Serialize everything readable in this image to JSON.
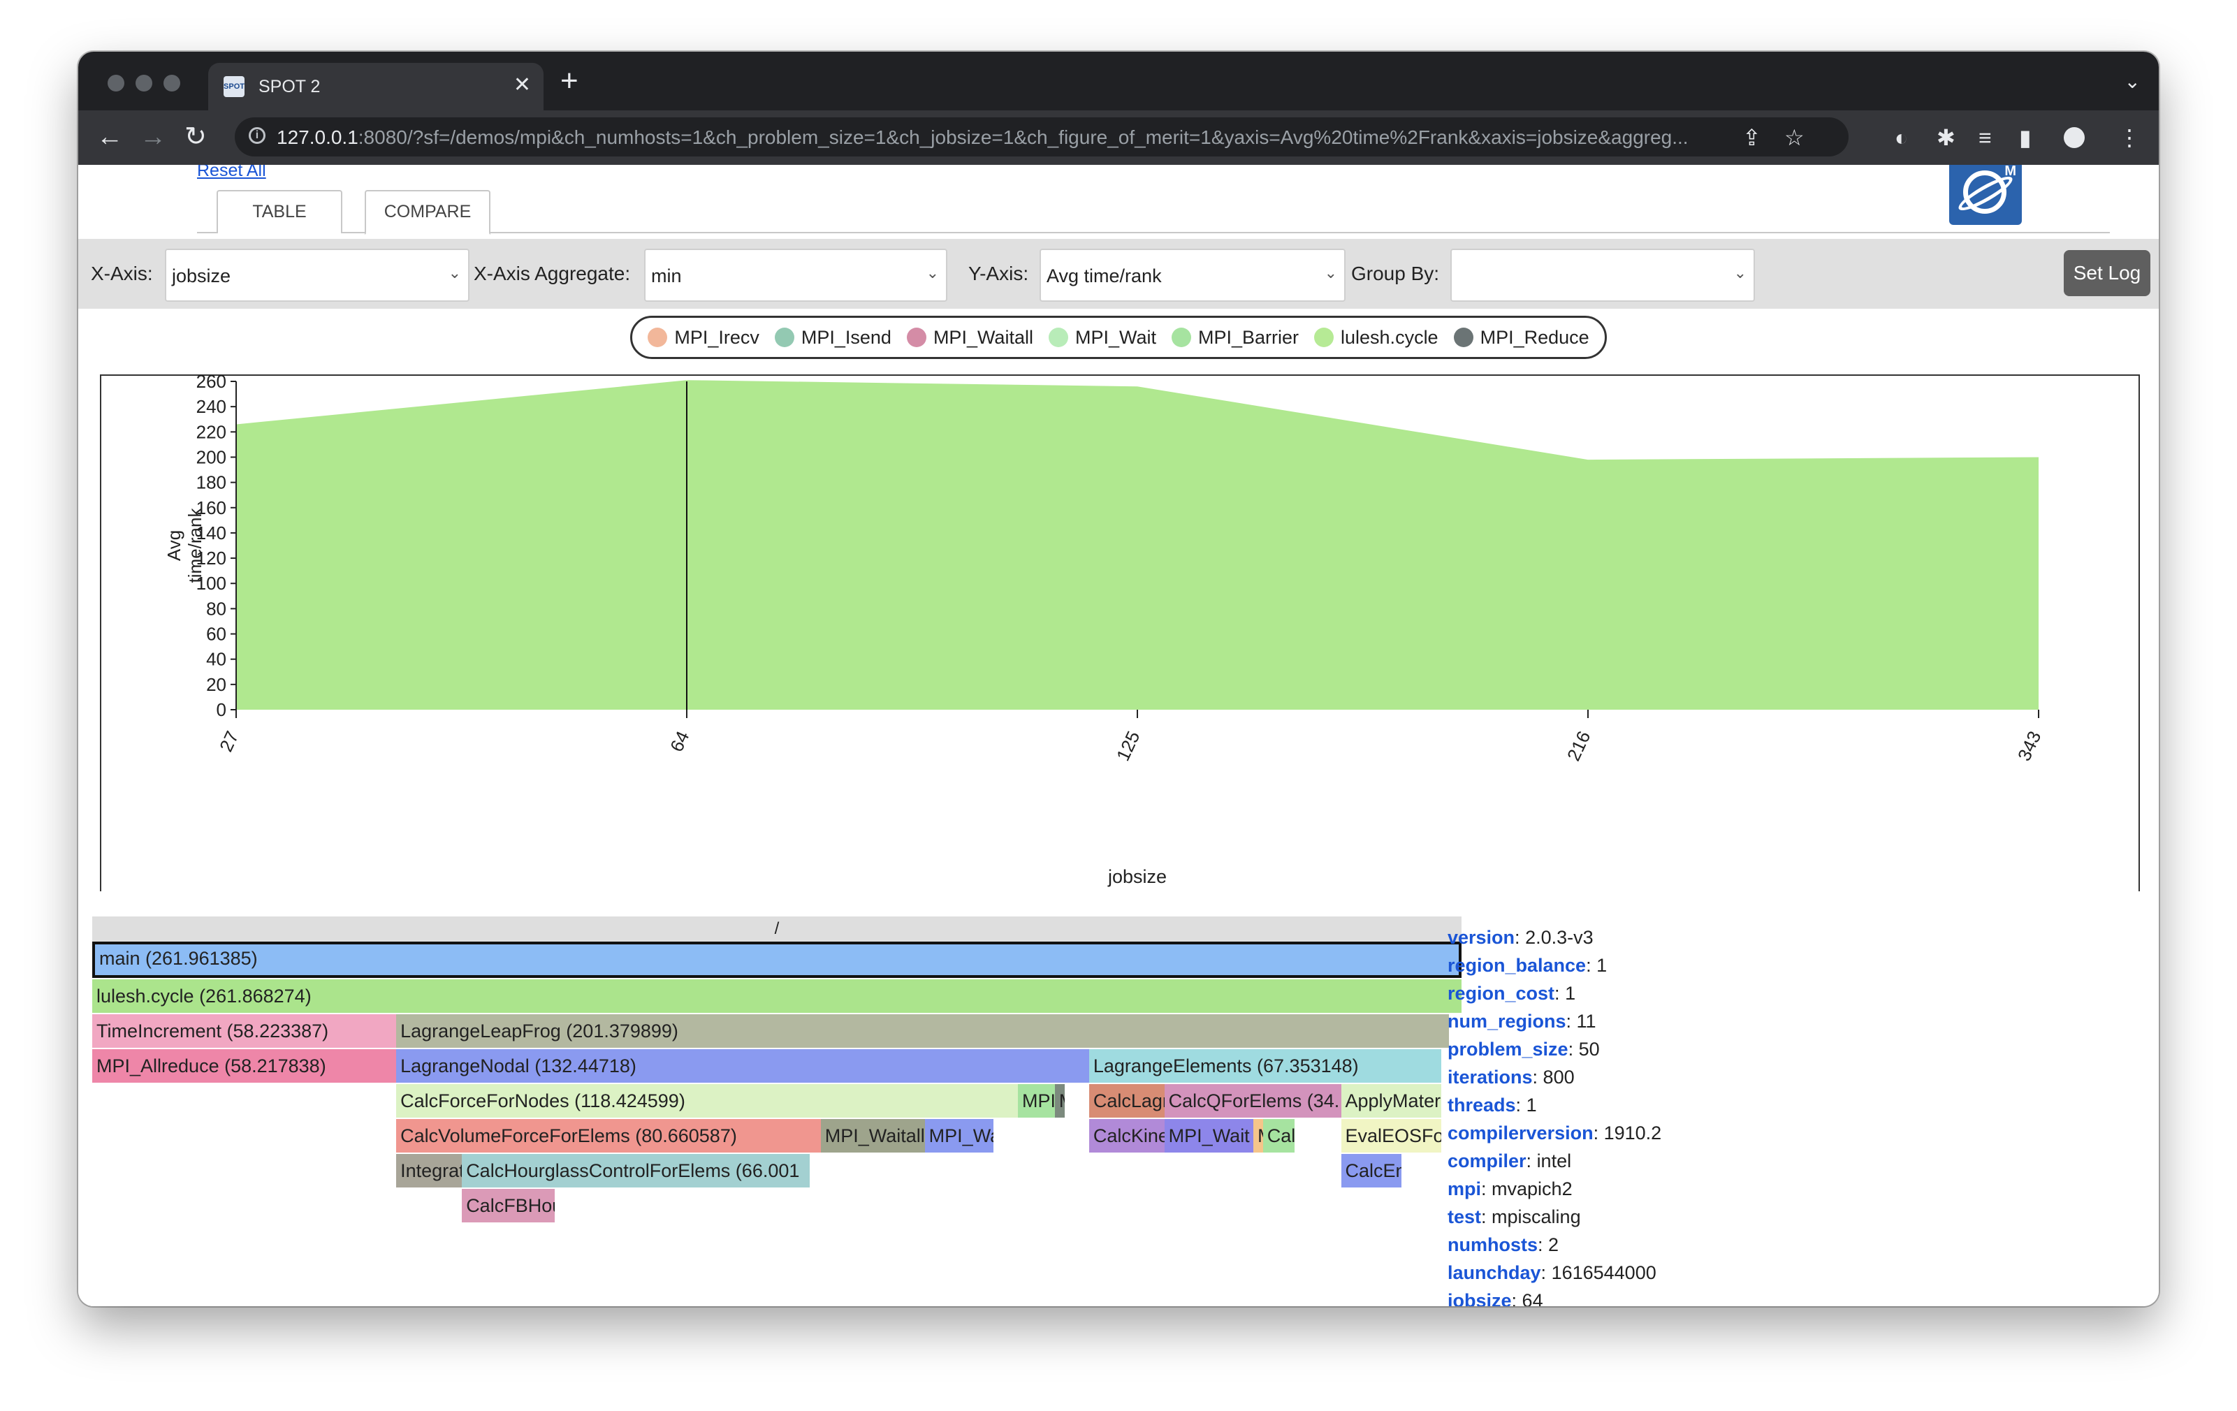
{
  "browser": {
    "tab_title": "SPOT 2",
    "tab_favicon": "SPOT",
    "url_host": "127.0.0.1",
    "url_rest": ":8080/?sf=/demos/mpi&ch_numhosts=1&ch_problem_size=1&ch_jobsize=1&ch_figure_of_merit=1&yaxis=Avg%20time%2Frank&xaxis=jobsize&aggreg..."
  },
  "page": {
    "reset_label": "Reset All",
    "tabs": [
      {
        "label": "TABLE"
      },
      {
        "label": "COMPARE"
      }
    ],
    "active_tab": 1
  },
  "controls": {
    "x_axis_label": "X-Axis:",
    "x_axis_value": "jobsize",
    "x_agg_label": "X-Axis Aggregate:",
    "x_agg_value": "min",
    "y_axis_label": "Y-Axis:",
    "y_axis_value": "Avg time/rank",
    "group_by_label": "Group By:",
    "group_by_value": "",
    "set_log_label": "Set Log"
  },
  "legend": [
    {
      "name": "MPI_Irecv",
      "color": "#f2b79a"
    },
    {
      "name": "MPI_Isend",
      "color": "#93c9b2"
    },
    {
      "name": "MPI_Waitall",
      "color": "#d48ca6"
    },
    {
      "name": "MPI_Wait",
      "color": "#b8ecb8"
    },
    {
      "name": "MPI_Barrier",
      "color": "#a6e3a0"
    },
    {
      "name": "lulesh.cycle",
      "color": "#b6ea95"
    },
    {
      "name": "MPI_Reduce",
      "color": "#6b7475"
    }
  ],
  "chart_data": {
    "type": "area",
    "categories": [
      "27",
      "64",
      "125",
      "216",
      "343"
    ],
    "series": [
      {
        "name": "lulesh.cycle",
        "values": [
          226,
          261,
          256,
          198,
          200
        ],
        "color": "#b0e88f"
      }
    ],
    "xlabel": "jobsize",
    "ylabel": "Avg time/rank",
    "yticks": [
      0,
      20,
      40,
      60,
      80,
      100,
      120,
      140,
      160,
      180,
      200,
      220,
      240,
      260
    ],
    "ylim": [
      0,
      260
    ],
    "highlight_category": "64"
  },
  "flamegraph": {
    "root_label": "/",
    "nodes": [
      {
        "label": "main (261.961385)",
        "depth": 0,
        "start": 0,
        "end": 1,
        "color": "#8cbcf5",
        "selected": true
      },
      {
        "label": "lulesh.cycle (261.868274)",
        "depth": 1,
        "start": 0,
        "end": 1,
        "color": "#abe48c"
      },
      {
        "label": "TimeIncrement (58.223387)",
        "depth": 2,
        "start": 0,
        "end": 0.222,
        "color": "#f1a7c2"
      },
      {
        "label": "LagrangeLeapFrog (201.379899)",
        "depth": 2,
        "start": 0.222,
        "end": 0.991,
        "color": "#b3b8a0"
      },
      {
        "label": "MPI_Allreduce (58.217838)",
        "depth": 3,
        "start": 0,
        "end": 0.222,
        "color": "#ee86a8"
      },
      {
        "label": "LagrangeNodal (132.44718)",
        "depth": 3,
        "start": 0.222,
        "end": 0.728,
        "color": "#8a9af0"
      },
      {
        "label": "LagrangeElements (67.353148)",
        "depth": 3,
        "start": 0.728,
        "end": 0.985,
        "color": "#9fdbe0"
      },
      {
        "label": "CalcForceForNodes (118.424599)",
        "depth": 4,
        "start": 0.222,
        "end": 0.676,
        "color": "#dcf2c4"
      },
      {
        "label": "MPI_Wait",
        "depth": 4,
        "start": 0.676,
        "end": 0.703,
        "color": "#a6e3a0"
      },
      {
        "label": "MPI_Reduce",
        "depth": 4,
        "start": 0.703,
        "end": 0.71,
        "color": "#7c8a7e"
      },
      {
        "label": "CalcLagrangeElements",
        "depth": 4,
        "start": 0.728,
        "end": 0.783,
        "color": "#d88c74"
      },
      {
        "label": "CalcQForElems (34.",
        "depth": 4,
        "start": 0.783,
        "end": 0.912,
        "color": "#d393bc"
      },
      {
        "label": "ApplyMaterialPropertiesForElems",
        "depth": 4,
        "start": 0.912,
        "end": 0.985,
        "color": "#dcf2c4"
      },
      {
        "label": "CalcVolumeForceForElems (80.660587)",
        "depth": 5,
        "start": 0.222,
        "end": 0.532,
        "color": "#f0968f"
      },
      {
        "label": "MPI_Waitall",
        "depth": 5,
        "start": 0.532,
        "end": 0.608,
        "color": "#9ea48c"
      },
      {
        "label": "MPI_Wait",
        "depth": 5,
        "start": 0.608,
        "end": 0.658,
        "color": "#8a9af0"
      },
      {
        "label": "CalcKinematicsForElems",
        "depth": 5,
        "start": 0.728,
        "end": 0.783,
        "color": "#b18ad8"
      },
      {
        "label": "MPI_Wait",
        "depth": 5,
        "start": 0.783,
        "end": 0.848,
        "color": "#8d86ea"
      },
      {
        "label": "MPI_Barrier",
        "depth": 5,
        "start": 0.848,
        "end": 0.855,
        "color": "#f5c58a"
      },
      {
        "label": "CalcMonotonicQForElems",
        "depth": 5,
        "start": 0.855,
        "end": 0.878,
        "color": "#a6e3a0"
      },
      {
        "label": "EvalEOSForElems",
        "depth": 5,
        "start": 0.912,
        "end": 0.985,
        "color": "#f1f5c4"
      },
      {
        "label": "IntegrateStressForElems",
        "depth": 6,
        "start": 0.222,
        "end": 0.27,
        "color": "#a8a598"
      },
      {
        "label": "CalcHourglassControlForElems (66.001",
        "depth": 6,
        "start": 0.27,
        "end": 0.524,
        "color": "#a3d0d1"
      },
      {
        "label": "CalcEnergyForElems",
        "depth": 6,
        "start": 0.912,
        "end": 0.956,
        "color": "#8a9af0"
      },
      {
        "label": "CalcFBHourglassForceForElems",
        "depth": 7,
        "start": 0.27,
        "end": 0.338,
        "color": "#db9ab7"
      }
    ]
  },
  "metadata": [
    {
      "key": "version",
      "value": "2.0.3-v3"
    },
    {
      "key": "region_balance",
      "value": "1"
    },
    {
      "key": "region_cost",
      "value": "1"
    },
    {
      "key": "num_regions",
      "value": "11"
    },
    {
      "key": "problem_size",
      "value": "50"
    },
    {
      "key": "iterations",
      "value": "800"
    },
    {
      "key": "threads",
      "value": "1"
    },
    {
      "key": "compilerversion",
      "value": "1910.2"
    },
    {
      "key": "compiler",
      "value": "intel"
    },
    {
      "key": "mpi",
      "value": "mvapich2"
    },
    {
      "key": "test",
      "value": "mpiscaling"
    },
    {
      "key": "numhosts",
      "value": "2"
    },
    {
      "key": "launchday",
      "value": "1616544000"
    },
    {
      "key": "jobsize",
      "value": "64"
    }
  ]
}
